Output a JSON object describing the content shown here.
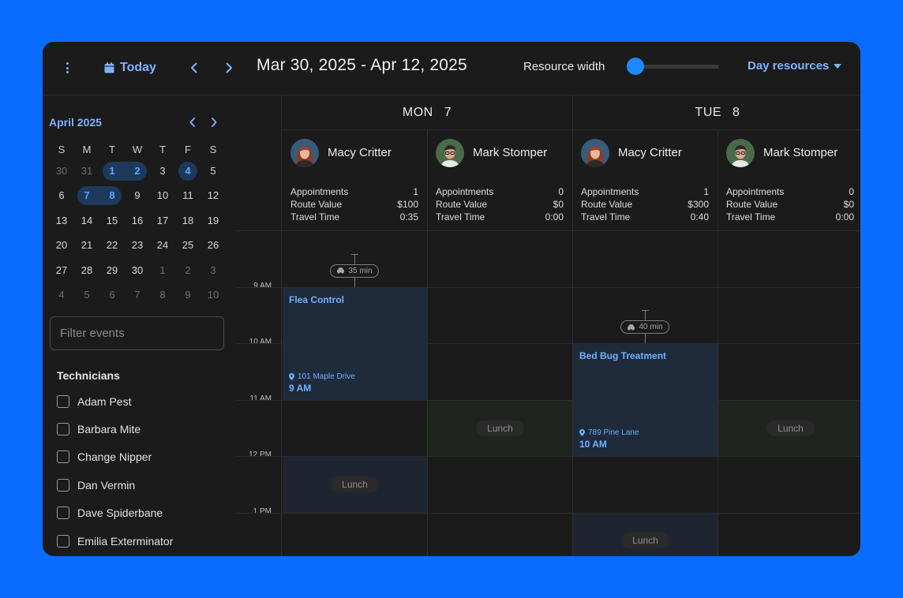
{
  "toolbar": {
    "today_label": "Today",
    "date_range": "Mar 30, 2025 - Apr 12, 2025",
    "resource_width_label": "Resource width",
    "resource_width_value": 0.05,
    "view_label": "Day resources"
  },
  "mini_calendar": {
    "title": "April 2025",
    "weekdays": [
      "S",
      "M",
      "T",
      "W",
      "T",
      "F",
      "S"
    ],
    "weeks": [
      [
        {
          "d": "30",
          "m": true
        },
        {
          "d": "31",
          "m": true
        },
        {
          "d": "1",
          "s": "start"
        },
        {
          "d": "2",
          "s": "end"
        },
        {
          "d": "3"
        },
        {
          "d": "4",
          "s": "single"
        },
        {
          "d": "5"
        }
      ],
      [
        {
          "d": "6"
        },
        {
          "d": "7",
          "s": "start"
        },
        {
          "d": "8",
          "s": "end"
        },
        {
          "d": "9"
        },
        {
          "d": "10"
        },
        {
          "d": "11"
        },
        {
          "d": "12"
        }
      ],
      [
        {
          "d": "13"
        },
        {
          "d": "14"
        },
        {
          "d": "15"
        },
        {
          "d": "16"
        },
        {
          "d": "17"
        },
        {
          "d": "18"
        },
        {
          "d": "19"
        }
      ],
      [
        {
          "d": "20"
        },
        {
          "d": "21"
        },
        {
          "d": "22"
        },
        {
          "d": "23"
        },
        {
          "d": "24"
        },
        {
          "d": "25"
        },
        {
          "d": "26"
        }
      ],
      [
        {
          "d": "27"
        },
        {
          "d": "28"
        },
        {
          "d": "29"
        },
        {
          "d": "30"
        },
        {
          "d": "1",
          "m": true
        },
        {
          "d": "2",
          "m": true
        },
        {
          "d": "3",
          "m": true
        }
      ],
      [
        {
          "d": "4",
          "m": true
        },
        {
          "d": "5",
          "m": true
        },
        {
          "d": "6",
          "m": true
        },
        {
          "d": "7",
          "m": true
        },
        {
          "d": "8",
          "m": true
        },
        {
          "d": "9",
          "m": true
        },
        {
          "d": "10",
          "m": true
        }
      ]
    ]
  },
  "filter": {
    "placeholder": "Filter events"
  },
  "technicians": {
    "title": "Technicians",
    "items": [
      "Adam Pest",
      "Barbara Mite",
      "Change Nipper",
      "Dan Vermin",
      "Dave Spiderbane",
      "Emilia Exterminator"
    ]
  },
  "times": [
    "9 AM",
    "10 AM",
    "11 AM",
    "12 PM",
    "1 PM"
  ],
  "days": [
    {
      "dow": "MON",
      "num": "7"
    },
    {
      "dow": "TUE",
      "num": "8"
    }
  ],
  "resources": [
    {
      "name": "Macy Critter",
      "avatar": "female",
      "appointments": "1",
      "route_value": "$100",
      "travel_time": "0:35"
    },
    {
      "name": "Mark Stomper",
      "avatar": "male",
      "appointments": "0",
      "route_value": "$0",
      "travel_time": "0:00"
    },
    {
      "name": "Macy Critter",
      "avatar": "female",
      "appointments": "1",
      "route_value": "$300",
      "travel_time": "0:40"
    },
    {
      "name": "Mark Stomper",
      "avatar": "male",
      "appointments": "0",
      "route_value": "$0",
      "travel_time": "0:00"
    }
  ],
  "stat_labels": {
    "appointments": "Appointments",
    "route_value": "Route Value",
    "travel_time": "Travel Time"
  },
  "events": [
    {
      "title": "Flea Control",
      "address": "101 Maple Drive",
      "time": "9 AM",
      "travel": "35 min"
    },
    {
      "title": "Bed Bug Treatment",
      "address": "789 Pine Lane",
      "time": "10 AM",
      "travel": "40 min"
    }
  ],
  "lunch_label": "Lunch",
  "colors": {
    "accent": "#1e88ff",
    "accent_text": "#7fb3ff",
    "page_bg": "#0a6cff",
    "panel_bg": "#1b1b1b",
    "event_bg": "#1f2b3a"
  }
}
